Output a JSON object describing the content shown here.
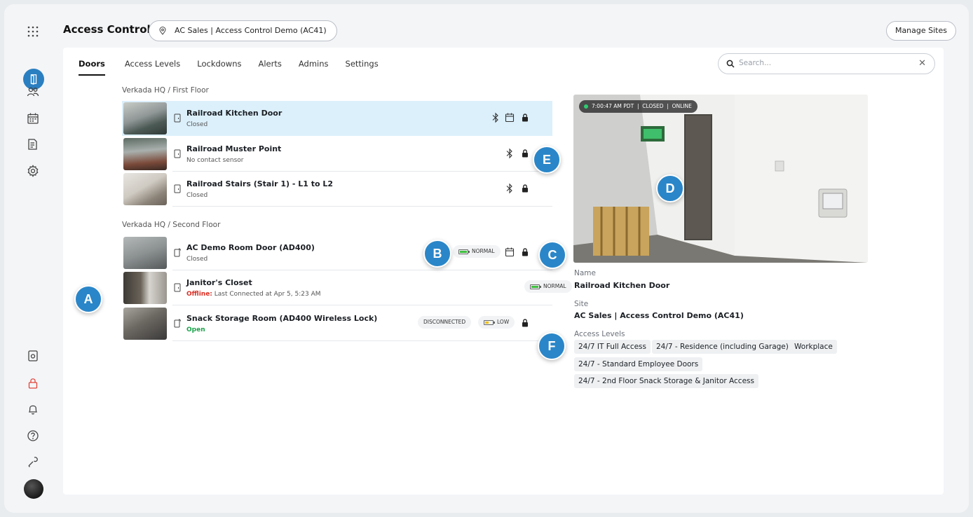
{
  "app": {
    "title": "Access Control",
    "site": "AC Sales | Access Control Demo (AC41)",
    "manage_sites": "Manage Sites"
  },
  "tabs": [
    "Doors",
    "Access Levels",
    "Lockdowns",
    "Alerts",
    "Admins",
    "Settings"
  ],
  "search": {
    "placeholder": "Search..."
  },
  "groups": [
    {
      "label": "Verkada HQ / First Floor",
      "doors": [
        {
          "name": "Railroad Kitchen Door",
          "status": "Closed",
          "selected": true
        },
        {
          "name": "Railroad Muster Point",
          "status": "No contact sensor"
        },
        {
          "name": "Railroad Stairs (Stair 1) - L1 to L2",
          "status": "Closed"
        }
      ]
    },
    {
      "label": "Verkada HQ / Second Floor",
      "doors": [
        {
          "name": "AC Demo Room Door (AD400)",
          "status": "Closed",
          "battery": "NORMAL"
        },
        {
          "name": "Janitor's Closet",
          "status_prefix": "Offline:",
          "status": "Last Connected at Apr 5, 5:23 AM",
          "battery": "NORMAL"
        },
        {
          "name": "Snack Storage Room (AD400 Wireless Lock)",
          "status": "Open",
          "connection": "DISCONNECTED",
          "battery": "LOW"
        }
      ]
    }
  ],
  "camera": {
    "time": "7:00:47 AM PDT",
    "door_state": "CLOSED",
    "camera_state": "ONLINE"
  },
  "detail": {
    "name_label": "Name",
    "name": "Railroad Kitchen Door",
    "site_label": "Site",
    "site": "AC Sales | Access Control Demo (AC41)",
    "levels_label": "Access Levels",
    "levels": [
      "24/7 IT Full Access",
      "24/7 - Residence (including Garage)",
      "Workplace",
      "24/7 - Standard Employee Doors",
      "24/7 - 2nd Floor Snack Storage & Janitor Access"
    ]
  },
  "markers": [
    "A",
    "B",
    "C",
    "D",
    "E",
    "F"
  ],
  "colors": {
    "accent": "#2a86c8",
    "selected_row": "#dcf0fb",
    "offline": "#d93025",
    "open": "#1aa34a",
    "battery_normal": "#3fbf3f",
    "battery_low": "#f2c200"
  }
}
